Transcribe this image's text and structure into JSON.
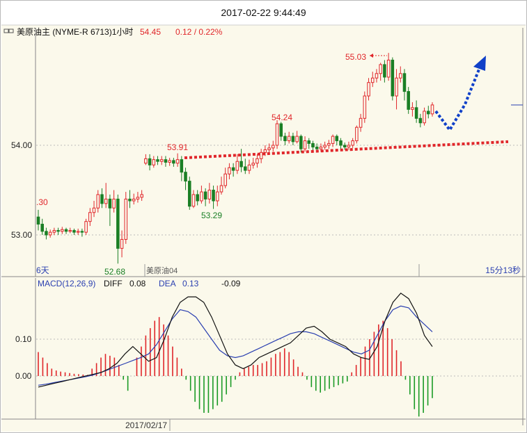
{
  "window": {
    "datetime": "2017-02-22 9:44:49"
  },
  "header": {
    "instrument": "美原油主 (NYME-R 6713)1小时",
    "last": "54.45",
    "change": "0.12 / 0.22%"
  },
  "colors": {
    "up": "#e0262a",
    "down": "#1a7f25",
    "macd_up": "#e0262a",
    "macd_down": "#1a9a25",
    "dif": "#111111",
    "dea": "#2a3fb0",
    "forecast_arrow": "#1040c8",
    "support": "#e0262a",
    "bg": "#fbf9eb"
  },
  "bottom_labels": {
    "left": "6天",
    "mid": "美原油04",
    "right": "15分13秒",
    "date": "2017/02/17"
  },
  "macd_header": {
    "label": "MACD(12,26,9)",
    "diff_label": "DIFF",
    "diff": "0.08",
    "dea_label": "DEA",
    "dea": "0.13",
    "macd": "-0.09"
  },
  "chart_data": [
    {
      "type": "candlestick",
      "ylim": [
        52.6,
        55.3
      ],
      "y_ticks": [
        {
          "label": "54.00",
          "value": 54.0
        },
        {
          "label": "53.00",
          "value": 53.0
        }
      ],
      "annotations": [
        {
          "text": "55.03",
          "value": 55.03,
          "color": "#e0262a",
          "arrow": true
        },
        {
          "text": "54.24",
          "value": 54.24,
          "color": "#e0262a"
        },
        {
          "text": "53.91",
          "value": 53.91,
          "color": "#e0262a"
        },
        {
          "text": "53.29",
          "value": 53.29,
          "color": "#1a7f25"
        },
        {
          "text": "52.68",
          "value": 52.68,
          "color": "#1a7f25"
        },
        {
          "text": ".30",
          "value": 53.3,
          "color": "#e0262a"
        }
      ],
      "candles": [
        [
          53.2,
          53.12,
          53.28,
          53.05
        ],
        [
          53.12,
          53.04,
          53.18,
          53.0
        ],
        [
          53.04,
          53.0,
          53.08,
          52.95
        ],
        [
          53.0,
          53.03,
          53.06,
          52.97
        ],
        [
          53.03,
          53.05,
          53.08,
          53.0
        ],
        [
          53.05,
          53.04,
          53.08,
          53.0
        ],
        [
          53.04,
          53.06,
          53.09,
          53.01
        ],
        [
          53.06,
          53.04,
          53.08,
          53.01
        ],
        [
          53.04,
          53.05,
          53.08,
          53.02
        ],
        [
          53.05,
          53.03,
          53.07,
          53.0
        ],
        [
          53.03,
          53.04,
          53.07,
          53.0
        ],
        [
          53.04,
          53.03,
          53.07,
          52.98
        ],
        [
          53.03,
          53.15,
          53.18,
          53.0
        ],
        [
          53.15,
          53.25,
          53.3,
          53.1
        ],
        [
          53.25,
          53.3,
          53.38,
          53.2
        ],
        [
          53.3,
          53.45,
          53.5,
          53.25
        ],
        [
          53.45,
          53.35,
          53.52,
          53.3
        ],
        [
          53.35,
          53.4,
          53.58,
          53.3
        ],
        [
          53.4,
          53.3,
          53.45,
          53.1
        ],
        [
          53.3,
          53.4,
          53.5,
          53.25
        ],
        [
          53.4,
          52.85,
          53.45,
          52.68
        ],
        [
          52.85,
          52.95,
          53.05,
          52.75
        ],
        [
          52.95,
          53.4,
          53.48,
          52.9
        ],
        [
          53.4,
          53.38,
          53.5,
          53.3
        ],
        [
          53.38,
          53.4,
          53.46,
          53.34
        ],
        [
          53.4,
          53.42,
          53.48,
          53.36
        ],
        [
          53.42,
          53.45,
          53.5,
          53.38
        ],
        [
          53.8,
          53.85,
          53.9,
          53.78
        ],
        [
          53.85,
          53.78,
          53.9,
          53.72
        ],
        [
          53.78,
          53.84,
          53.88,
          53.75
        ],
        [
          53.84,
          53.82,
          53.88,
          53.78
        ],
        [
          53.82,
          53.84,
          53.88,
          53.78
        ],
        [
          53.84,
          53.81,
          53.88,
          53.76
        ],
        [
          53.81,
          53.83,
          53.86,
          53.77
        ],
        [
          53.83,
          53.8,
          53.86,
          53.76
        ],
        [
          53.8,
          53.84,
          53.91,
          53.76
        ],
        [
          53.84,
          53.7,
          53.88,
          53.6
        ],
        [
          53.7,
          53.6,
          53.75,
          53.5
        ],
        [
          53.6,
          53.32,
          53.65,
          53.28
        ],
        [
          53.32,
          53.45,
          53.5,
          53.3
        ],
        [
          53.45,
          53.38,
          53.5,
          53.33
        ],
        [
          53.38,
          53.48,
          53.55,
          53.35
        ],
        [
          53.48,
          53.4,
          53.52,
          53.32
        ],
        [
          53.4,
          53.5,
          53.58,
          53.35
        ],
        [
          53.5,
          53.38,
          53.55,
          53.29
        ],
        [
          53.38,
          53.48,
          53.55,
          53.32
        ],
        [
          53.48,
          53.55,
          53.65,
          53.45
        ],
        [
          53.55,
          53.68,
          53.75,
          53.52
        ],
        [
          53.68,
          53.75,
          53.8,
          53.62
        ],
        [
          53.75,
          53.72,
          53.8,
          53.65
        ],
        [
          53.72,
          53.82,
          53.9,
          53.68
        ],
        [
          53.82,
          53.76,
          53.96,
          53.7
        ],
        [
          53.76,
          53.72,
          53.85,
          53.68
        ],
        [
          53.72,
          53.78,
          53.84,
          53.68
        ],
        [
          53.78,
          53.8,
          53.86,
          53.74
        ],
        [
          53.8,
          53.85,
          53.9,
          53.75
        ],
        [
          53.85,
          53.92,
          53.96,
          53.8
        ],
        [
          53.92,
          53.95,
          54.0,
          53.88
        ],
        [
          53.95,
          53.97,
          54.02,
          53.92
        ],
        [
          53.97,
          54.0,
          54.05,
          53.93
        ],
        [
          54.0,
          54.24,
          54.28,
          53.96
        ],
        [
          54.24,
          54.1,
          54.26,
          54.05
        ],
        [
          54.1,
          54.05,
          54.14,
          54.0
        ],
        [
          54.05,
          54.1,
          54.15,
          54.02
        ],
        [
          54.1,
          54.04,
          54.14,
          54.0
        ],
        [
          54.04,
          54.1,
          54.16,
          54.02
        ],
        [
          54.1,
          53.96,
          54.12,
          53.92
        ],
        [
          53.96,
          54.05,
          54.1,
          53.93
        ],
        [
          54.05,
          54.02,
          54.08,
          53.96
        ],
        [
          54.02,
          53.98,
          54.05,
          53.94
        ],
        [
          53.98,
          53.96,
          54.02,
          53.92
        ],
        [
          53.96,
          53.98,
          54.02,
          53.93
        ],
        [
          53.98,
          54.0,
          54.04,
          53.95
        ],
        [
          54.0,
          54.02,
          54.06,
          53.96
        ],
        [
          54.02,
          54.1,
          54.12,
          53.98
        ],
        [
          54.1,
          54.05,
          54.12,
          54.0
        ],
        [
          54.05,
          54.0,
          54.08,
          53.96
        ],
        [
          54.0,
          53.98,
          54.03,
          53.95
        ],
        [
          53.98,
          54.0,
          54.04,
          53.95
        ],
        [
          54.0,
          54.05,
          54.08,
          53.97
        ],
        [
          54.05,
          54.2,
          54.22,
          54.02
        ],
        [
          54.2,
          54.3,
          54.35,
          54.15
        ],
        [
          54.3,
          54.55,
          54.6,
          54.25
        ],
        [
          54.55,
          54.7,
          54.75,
          54.5
        ],
        [
          54.7,
          54.75,
          54.82,
          54.65
        ],
        [
          54.75,
          54.8,
          54.85,
          54.7
        ],
        [
          54.8,
          54.9,
          54.92,
          54.72
        ],
        [
          54.9,
          54.76,
          54.95,
          54.7
        ],
        [
          54.76,
          54.95,
          55.03,
          54.72
        ],
        [
          54.95,
          54.55,
          54.98,
          54.5
        ],
        [
          54.55,
          54.75,
          54.85,
          54.4
        ],
        [
          54.75,
          54.8,
          54.88,
          54.7
        ],
        [
          54.8,
          54.6,
          54.85,
          54.5
        ],
        [
          54.6,
          54.4,
          54.65,
          54.35
        ],
        [
          54.4,
          54.42,
          54.48,
          54.32
        ],
        [
          54.42,
          54.3,
          54.5,
          54.25
        ],
        [
          54.3,
          54.25,
          54.35,
          54.2
        ],
        [
          54.25,
          54.38,
          54.42,
          54.22
        ],
        [
          54.38,
          54.35,
          54.44,
          54.3
        ],
        [
          54.35,
          54.45,
          54.48,
          54.32
        ]
      ],
      "support_line": {
        "from": 53.86,
        "to": 54.04
      },
      "forecast": "down-then-up"
    },
    {
      "type": "bar+line",
      "ylim": [
        -0.11,
        0.24
      ],
      "y_ticks": [
        {
          "label": "0.10",
          "value": 0.1
        },
        {
          "label": "0.00",
          "value": 0.0
        }
      ],
      "hist": [
        0.065,
        0.05,
        0.035,
        0.02,
        0.015,
        0.012,
        0.01,
        0.008,
        0.006,
        0.005,
        0.004,
        0.003,
        0.02,
        0.035,
        0.05,
        0.06,
        0.055,
        0.05,
        0.03,
        -0.01,
        -0.04,
        0.0,
        0.05,
        0.08,
        0.11,
        0.13,
        0.15,
        0.16,
        0.14,
        0.11,
        0.08,
        0.05,
        0.02,
        -0.01,
        -0.04,
        -0.07,
        -0.09,
        -0.1,
        -0.1,
        -0.09,
        -0.08,
        -0.07,
        -0.05,
        -0.03,
        -0.01,
        0.01,
        0.02,
        0.025,
        0.03,
        0.03,
        0.035,
        0.04,
        0.05,
        0.06,
        0.065,
        0.075,
        0.065,
        0.045,
        0.025,
        0.01,
        -0.01,
        -0.03,
        -0.04,
        -0.045,
        -0.04,
        -0.035,
        -0.03,
        -0.025,
        -0.02,
        -0.015,
        0.01,
        0.03,
        0.05,
        0.08,
        0.1,
        0.12,
        0.14,
        0.15,
        0.13,
        0.1,
        0.07,
        0.04,
        -0.01,
        -0.05,
        -0.09,
        -0.11,
        -0.1,
        -0.08,
        -0.06
      ],
      "dif": [
        -0.03,
        -0.025,
        -0.02,
        -0.015,
        -0.01,
        -0.005,
        0.0,
        0.005,
        0.01,
        0.02,
        0.035,
        0.06,
        0.08,
        0.06,
        0.04,
        0.05,
        0.1,
        0.16,
        0.2,
        0.215,
        0.215,
        0.2,
        0.16,
        0.11,
        0.06,
        0.03,
        0.02,
        0.03,
        0.05,
        0.06,
        0.07,
        0.08,
        0.09,
        0.11,
        0.13,
        0.135,
        0.12,
        0.1,
        0.09,
        0.08,
        0.06,
        0.05,
        0.045,
        0.08,
        0.15,
        0.2,
        0.225,
        0.21,
        0.17,
        0.11,
        0.08
      ],
      "dea": [
        -0.025,
        -0.022,
        -0.018,
        -0.014,
        -0.01,
        -0.006,
        -0.002,
        0.003,
        0.01,
        0.018,
        0.026,
        0.034,
        0.042,
        0.05,
        0.06,
        0.085,
        0.12,
        0.155,
        0.18,
        0.175,
        0.16,
        0.13,
        0.1,
        0.07,
        0.055,
        0.05,
        0.055,
        0.065,
        0.075,
        0.085,
        0.095,
        0.105,
        0.115,
        0.12,
        0.12,
        0.115,
        0.105,
        0.095,
        0.085,
        0.075,
        0.065,
        0.06,
        0.07,
        0.11,
        0.15,
        0.18,
        0.19,
        0.185,
        0.16,
        0.14,
        0.12
      ]
    }
  ]
}
